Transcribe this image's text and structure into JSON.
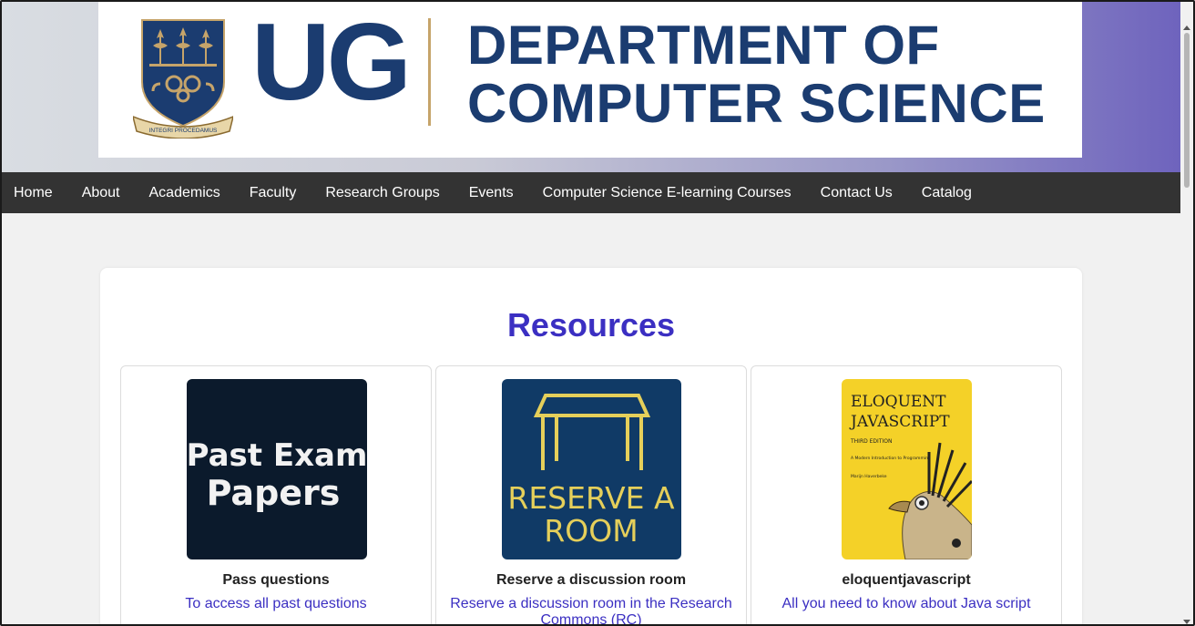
{
  "banner": {
    "logo_text": "UG",
    "dept_line1": "DEPARTMENT OF",
    "dept_line2": "COMPUTER SCIENCE",
    "motto": "INTEGRI PROCEDAMUS",
    "brand_color": "#1b3c70",
    "accent_color": "#c6a46a"
  },
  "nav": {
    "items": [
      "Home",
      "About",
      "Academics",
      "Faculty",
      "Research Groups",
      "Events",
      "Computer Science E-learning Courses",
      "Contact Us",
      "Catalog"
    ]
  },
  "resources": {
    "title": "Resources",
    "tiles": [
      {
        "image_text": [
          "Past Exam",
          "Papers"
        ],
        "heading": "Pass questions",
        "link": "To access all past questions"
      },
      {
        "image_text": [
          "RESERVE A",
          "ROOM"
        ],
        "heading": "Reserve a discussion room",
        "link": "Reserve a discussion room in the Research Commons (RC)"
      },
      {
        "image_text": [
          "ELOQUENT",
          "JAVASCRIPT",
          "THIRD EDITION",
          "A Modern Introduction to Programming",
          "Marijn Haverbeke"
        ],
        "heading": "eloquentjavascript",
        "link": "All you need to know about Java script"
      }
    ]
  }
}
